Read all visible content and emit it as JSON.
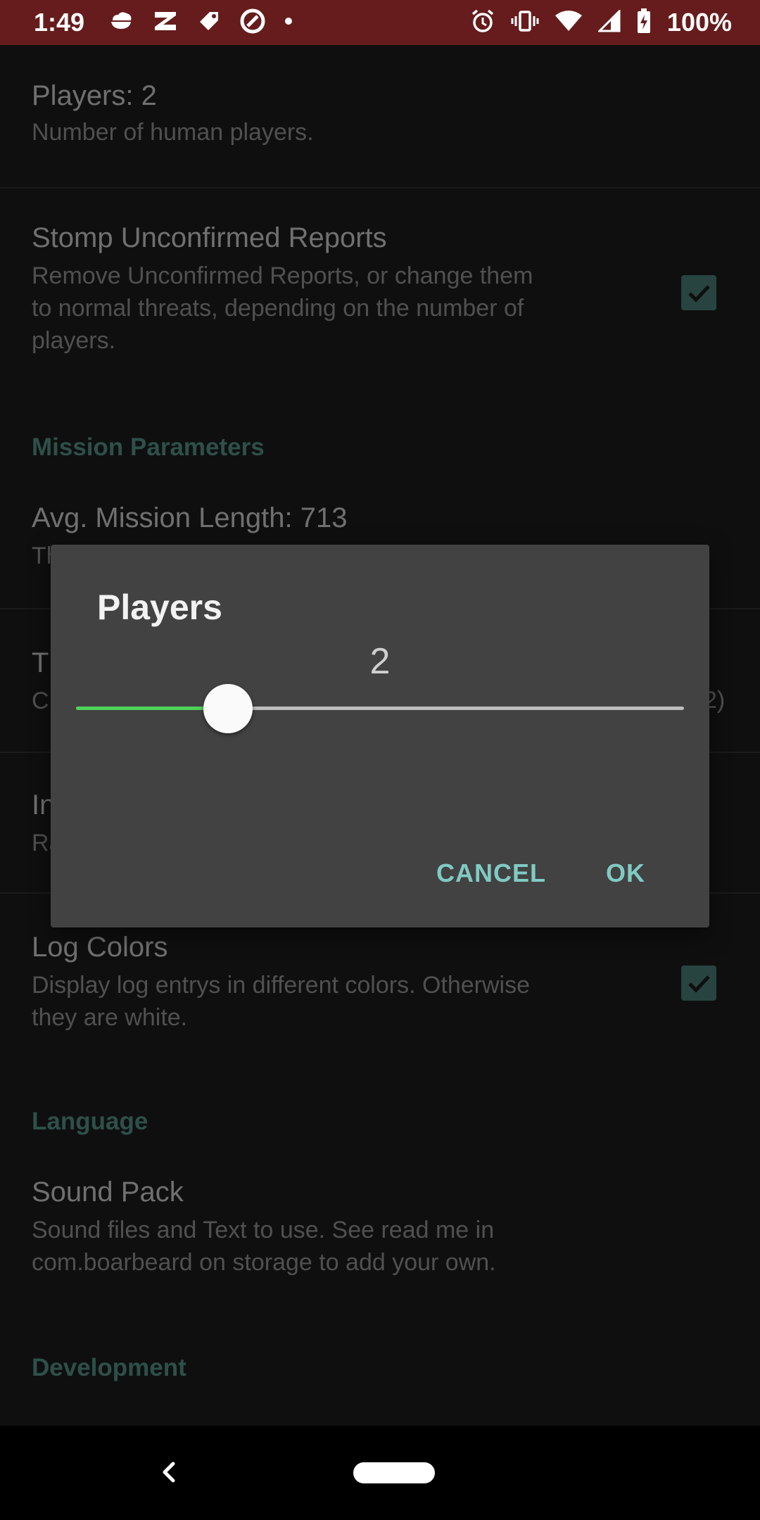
{
  "status_bar": {
    "time": "1:49",
    "battery_text": "100%",
    "icons_left": [
      "cloud-icon",
      "notification-icon",
      "tag-icon",
      "circle-app-icon",
      "dot-icon"
    ],
    "icons_right": [
      "alarm-icon",
      "vibrate-icon",
      "wifi-icon",
      "signal-icon",
      "battery-charging-icon"
    ]
  },
  "settings": {
    "players": {
      "title": "Players: 2",
      "summary": "Number of human players."
    },
    "stomp": {
      "title": "Stomp Unconfirmed Reports",
      "summary_line1": "Remove Unconfirmed Reports, or change them",
      "summary_line2": "to normal threats, depending on the number of",
      "summary_line3": "players.",
      "checked": true
    },
    "category_mission": "Mission Parameters",
    "mission_length": {
      "title": "Avg. Mission Length: 713",
      "summary": "Th"
    },
    "partial_item_1": {
      "title": "T",
      "summary": "C",
      "summary_right": "2)"
    },
    "partial_item_2": {
      "title": "In",
      "summary": "Ra"
    },
    "log_colors": {
      "title": "Log Colors",
      "summary_line1": "Display log entrys in different colors. Otherwise",
      "summary_line2": "they are white.",
      "checked": true
    },
    "category_language": "Language",
    "sound_pack": {
      "title": "Sound Pack",
      "summary_line1": "Sound files and Text to use. See read me in",
      "summary_line2": "com.boarbeard on storage to add your own."
    },
    "category_development": "Development"
  },
  "dialog": {
    "title": "Players",
    "value": "2",
    "slider_fraction": 0.25,
    "cancel_label": "CANCEL",
    "ok_label": "OK"
  },
  "colors": {
    "status_bar": "#661c1c",
    "accent": "#80cbc4",
    "slider_fill": "#4fd159",
    "category": "#3f6f66"
  }
}
